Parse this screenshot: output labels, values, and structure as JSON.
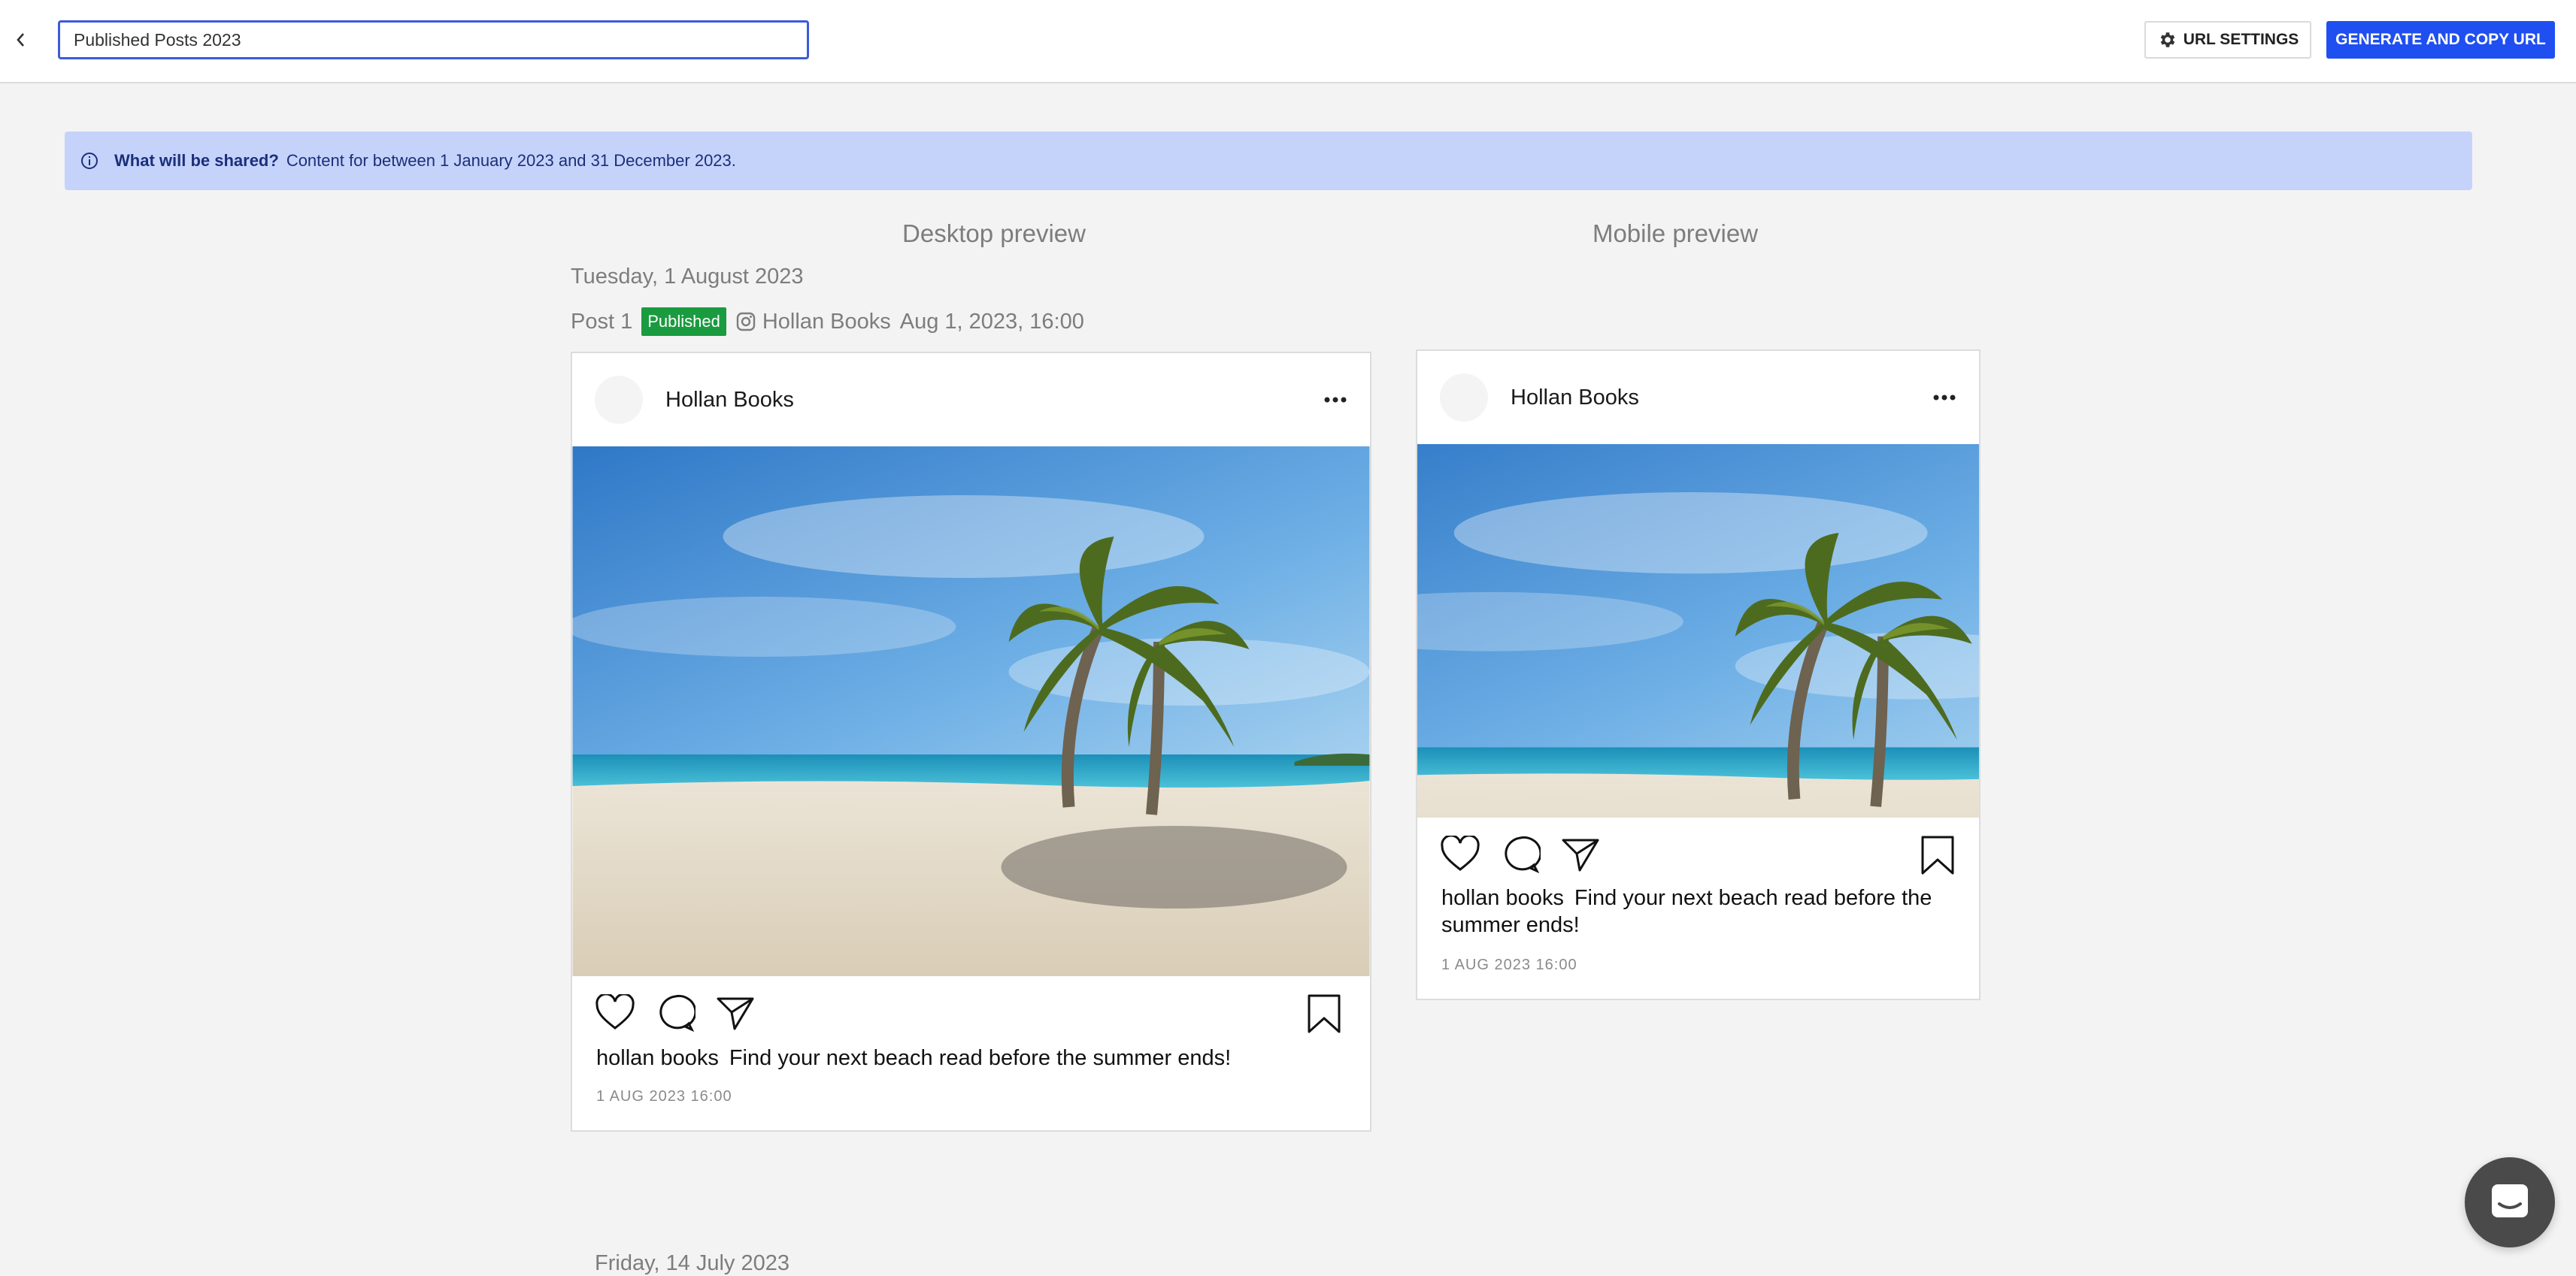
{
  "header": {
    "share_title": "Published Posts 2023",
    "url_settings_label": "URL SETTINGS",
    "generate_label": "GENERATE AND COPY URL",
    "back_icon": "chevron-left-icon",
    "settings_icon": "gear-icon"
  },
  "banner": {
    "question": "What will be shared?",
    "message": "Content for between 1 January 2023 and 31 December 2023.",
    "icon": "info-icon",
    "color": "#c5d3fb"
  },
  "previews": {
    "desktop_heading": "Desktop preview",
    "mobile_heading": "Mobile preview"
  },
  "day_group": {
    "date": "Tuesday, 1 August 2023",
    "post_label": "Post 1",
    "status": "Published",
    "status_color": "#1a9b3f",
    "account": "Hollan Books",
    "datetime": "Aug 1, 2023, 16:00",
    "network_icon": "instagram-icon"
  },
  "post": {
    "account_name": "Hollan Books",
    "username": "hollan books",
    "caption": "Find your next beach read before the summer ends!",
    "timestamp": "1 AUG 2023 16:00",
    "image": "beach-palm-trees-image"
  },
  "next_day_group": {
    "date": "Friday, 14 July 2023"
  },
  "colors": {
    "primary_button": "#1f4ff0",
    "background": "#f3f3f3"
  }
}
